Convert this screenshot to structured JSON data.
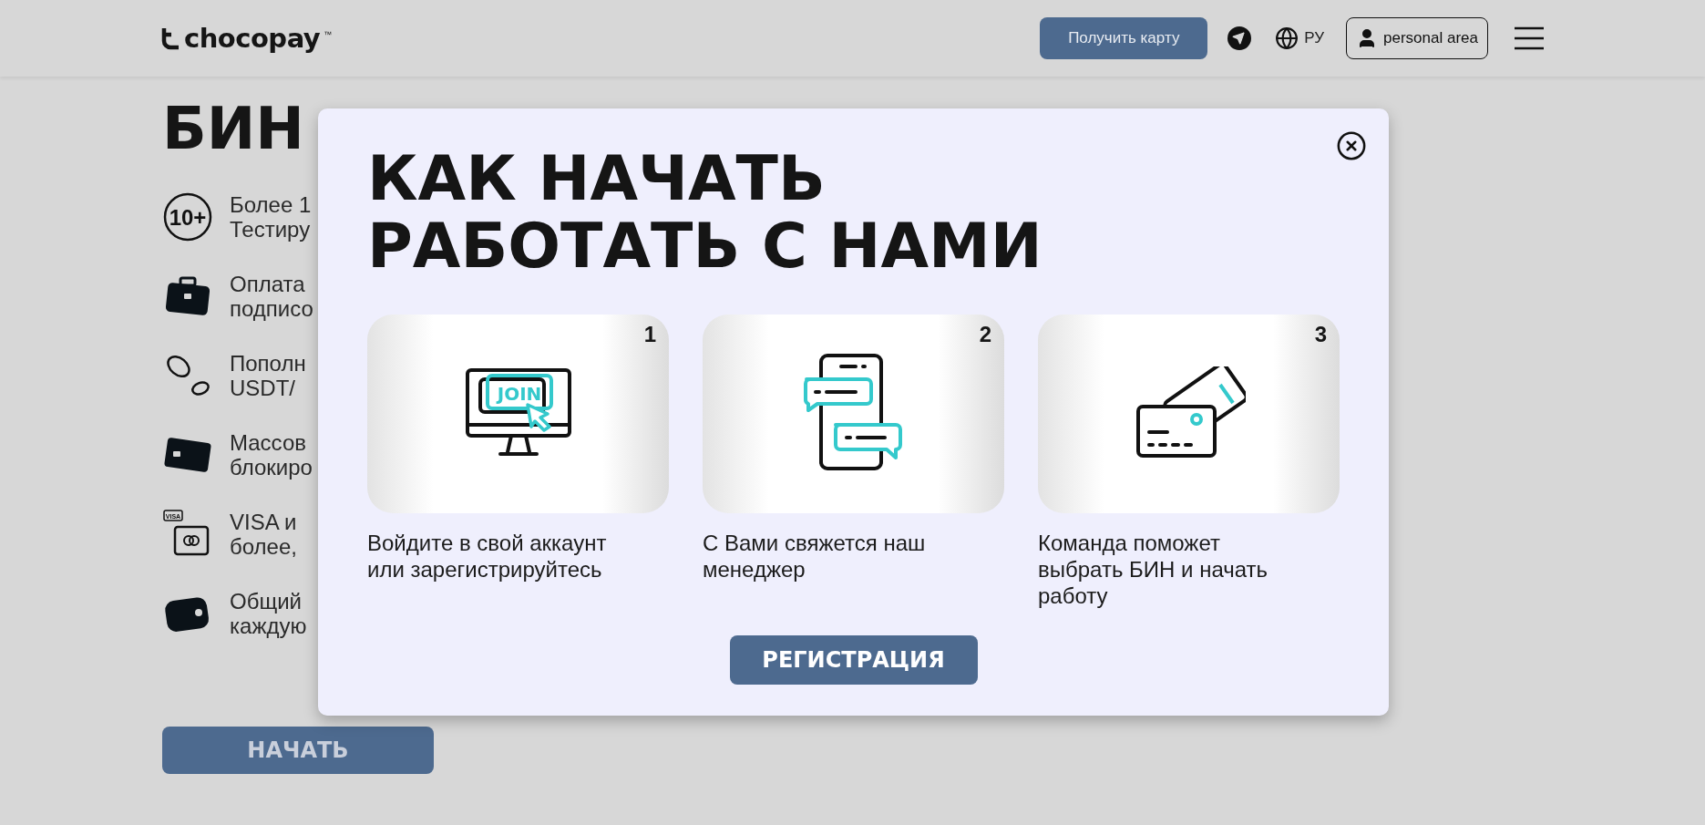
{
  "header": {
    "logo": "chocopay",
    "logo_mark": "™",
    "get_card_button": "Получить карту",
    "language": "РУ",
    "account_button": "personal area"
  },
  "page": {
    "heading": "БИН",
    "features": [
      {
        "kind": "badge",
        "icon_text": "10+",
        "text": "Более 1\nТестиру"
      },
      {
        "kind": "briefcase",
        "text": "Оплата\nподписо"
      },
      {
        "kind": "coins",
        "text": "Пополн\nUSDT/"
      },
      {
        "kind": "card",
        "text": "Массов\nблокиро"
      },
      {
        "kind": "visa",
        "icon_text": "VISA",
        "text": "VISA и\nболее,"
      },
      {
        "kind": "wallet",
        "text": "Общий\nкаждую"
      }
    ],
    "start_button": "НАЧАТЬ"
  },
  "modal": {
    "title_lines": [
      "КАК НАЧАТЬ",
      "РАБОТАТЬ С НАМИ"
    ],
    "steps": [
      {
        "number": "1",
        "kind": "join",
        "icon_text": "JOIN",
        "caption": "Войдите в свой аккаунт или зарегистрируйтесь"
      },
      {
        "number": "2",
        "kind": "chat",
        "caption": "С Вами свяжется наш менеджер"
      },
      {
        "number": "3",
        "kind": "cards",
        "caption": "Команда поможет выбрать БИН и начать работу"
      }
    ],
    "register_button": "РЕГИСТРАЦИЯ"
  }
}
